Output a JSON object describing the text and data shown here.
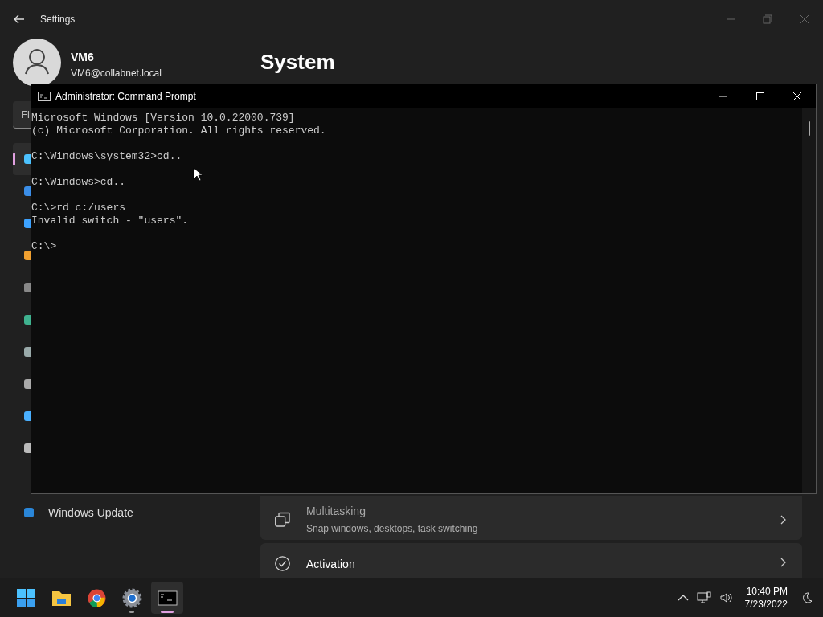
{
  "settings": {
    "title": "Settings",
    "user": {
      "name": "VM6",
      "email": "VM6@collabnet.local"
    },
    "search": {
      "placeholder": "Fi"
    },
    "page_title": "System",
    "nav_items": [
      {
        "selected": true
      },
      {
        "selected": false
      },
      {
        "selected": false
      },
      {
        "selected": false
      },
      {
        "selected": false
      },
      {
        "selected": false
      },
      {
        "selected": false
      },
      {
        "selected": false
      },
      {
        "selected": false
      },
      {
        "selected": false
      },
      {
        "selected": false,
        "label": "Windows Update"
      }
    ],
    "cards": [
      {
        "title": "Multitasking",
        "subtitle": "Snap windows, desktops, task switching",
        "dimmed": true
      },
      {
        "title": "Activation",
        "dimmed": false
      }
    ]
  },
  "console": {
    "title": "Administrator: Command Prompt",
    "blocks": [
      [
        "Microsoft Windows [Version 10.0.22000.739]",
        "(c) Microsoft Corporation. All rights reserved."
      ],
      [
        "C:\\Windows\\system32>cd.."
      ],
      [
        "C:\\Windows>cd.."
      ],
      [
        "C:\\>rd c:/users",
        "Invalid switch - \"users\"."
      ],
      [
        "C:\\>"
      ]
    ]
  },
  "taskbar": {
    "apps": [
      {
        "open": false,
        "selected": false
      },
      {
        "open": false,
        "selected": false
      },
      {
        "open": false,
        "selected": false
      },
      {
        "open": true,
        "selected": false
      },
      {
        "open": true,
        "selected": true
      }
    ],
    "time": "10:40 PM",
    "date": "7/23/2022"
  }
}
